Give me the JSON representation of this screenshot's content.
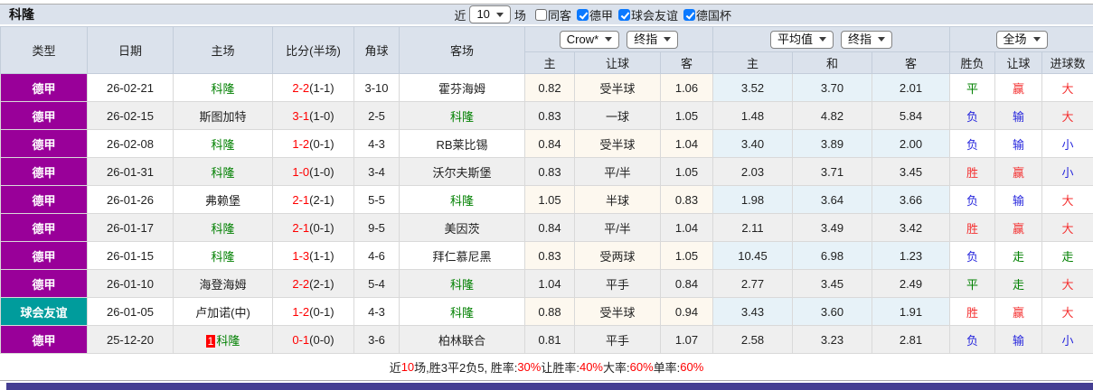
{
  "title": "科隆",
  "toolbar": {
    "near_label": "近",
    "games_select": "10",
    "games_label": "场",
    "checkboxes": [
      {
        "label": "同客",
        "checked": false
      },
      {
        "label": "德甲",
        "checked": true
      },
      {
        "label": "球会友谊",
        "checked": true
      },
      {
        "label": "德国杯",
        "checked": true
      }
    ]
  },
  "table": {
    "columns": [
      "类型",
      "日期",
      "主场",
      "比分(半场)",
      "角球",
      "客场"
    ],
    "selects": {
      "crow": "Crow*",
      "crow_final": "终指",
      "avg": "平均值",
      "avg_final": "终指",
      "scope": "全场"
    },
    "odds_subheaders": [
      "主",
      "让球",
      "客",
      "主",
      "和",
      "客",
      "胜负",
      "让球",
      "进球数"
    ],
    "rows": [
      {
        "type": "德甲",
        "type_color": "#990099",
        "date": "26-02-21",
        "home": "科隆",
        "home_green": true,
        "home_badge": "",
        "score": "2-2",
        "half": "(1-1)",
        "corner": "3-10",
        "away": "霍芬海姆",
        "away_green": false,
        "crow_home": "0.82",
        "crow_handicap": "受半球",
        "crow_away": "1.06",
        "avg_home": "3.52",
        "avg_draw": "3.70",
        "avg_away": "2.01",
        "res_outcome": "平",
        "res_outcome_color": "green",
        "res_handicap": "赢",
        "res_handicap_color": "red",
        "res_goals": "大",
        "res_goals_color": "red"
      },
      {
        "type": "德甲",
        "type_color": "#990099",
        "date": "26-02-15",
        "home": "斯图加特",
        "home_green": false,
        "home_badge": "",
        "score": "3-1",
        "half": "(1-0)",
        "corner": "2-5",
        "away": "科隆",
        "away_green": true,
        "crow_home": "0.83",
        "crow_handicap": "一球",
        "crow_away": "1.05",
        "avg_home": "1.48",
        "avg_draw": "4.82",
        "avg_away": "5.84",
        "res_outcome": "负",
        "res_outcome_color": "blue",
        "res_handicap": "输",
        "res_handicap_color": "blue",
        "res_goals": "大",
        "res_goals_color": "red"
      },
      {
        "type": "德甲",
        "type_color": "#990099",
        "date": "26-02-08",
        "home": "科隆",
        "home_green": true,
        "home_badge": "",
        "score": "1-2",
        "half": "(0-1)",
        "corner": "4-3",
        "away": "RB莱比锡",
        "away_green": false,
        "crow_home": "0.84",
        "crow_handicap": "受半球",
        "crow_away": "1.04",
        "avg_home": "3.40",
        "avg_draw": "3.89",
        "avg_away": "2.00",
        "res_outcome": "负",
        "res_outcome_color": "blue",
        "res_handicap": "输",
        "res_handicap_color": "blue",
        "res_goals": "小",
        "res_goals_color": "blue"
      },
      {
        "type": "德甲",
        "type_color": "#990099",
        "date": "26-01-31",
        "home": "科隆",
        "home_green": true,
        "home_badge": "",
        "score": "1-0",
        "half": "(1-0)",
        "corner": "3-4",
        "away": "沃尔夫斯堡",
        "away_green": false,
        "crow_home": "0.83",
        "crow_handicap": "平/半",
        "crow_away": "1.05",
        "avg_home": "2.03",
        "avg_draw": "3.71",
        "avg_away": "3.45",
        "res_outcome": "胜",
        "res_outcome_color": "red",
        "res_handicap": "赢",
        "res_handicap_color": "red",
        "res_goals": "小",
        "res_goals_color": "blue"
      },
      {
        "type": "德甲",
        "type_color": "#990099",
        "date": "26-01-26",
        "home": "弗赖堡",
        "home_green": false,
        "home_badge": "",
        "score": "2-1",
        "half": "(2-1)",
        "corner": "5-5",
        "away": "科隆",
        "away_green": true,
        "crow_home": "1.05",
        "crow_handicap": "半球",
        "crow_away": "0.83",
        "avg_home": "1.98",
        "avg_draw": "3.64",
        "avg_away": "3.66",
        "res_outcome": "负",
        "res_outcome_color": "blue",
        "res_handicap": "输",
        "res_handicap_color": "blue",
        "res_goals": "大",
        "res_goals_color": "red"
      },
      {
        "type": "德甲",
        "type_color": "#990099",
        "date": "26-01-17",
        "home": "科隆",
        "home_green": true,
        "home_badge": "",
        "score": "2-1",
        "half": "(0-1)",
        "corner": "9-5",
        "away": "美因茨",
        "away_green": false,
        "crow_home": "0.84",
        "crow_handicap": "平/半",
        "crow_away": "1.04",
        "avg_home": "2.11",
        "avg_draw": "3.49",
        "avg_away": "3.42",
        "res_outcome": "胜",
        "res_outcome_color": "red",
        "res_handicap": "赢",
        "res_handicap_color": "red",
        "res_goals": "大",
        "res_goals_color": "red"
      },
      {
        "type": "德甲",
        "type_color": "#990099",
        "date": "26-01-15",
        "home": "科隆",
        "home_green": true,
        "home_badge": "",
        "score": "1-3",
        "half": "(1-1)",
        "corner": "4-6",
        "away": "拜仁慕尼黑",
        "away_green": false,
        "crow_home": "0.83",
        "crow_handicap": "受两球",
        "crow_away": "1.05",
        "avg_home": "10.45",
        "avg_draw": "6.98",
        "avg_away": "1.23",
        "res_outcome": "负",
        "res_outcome_color": "blue",
        "res_handicap": "走",
        "res_handicap_color": "green",
        "res_goals": "走",
        "res_goals_color": "green"
      },
      {
        "type": "德甲",
        "type_color": "#990099",
        "date": "26-01-10",
        "home": "海登海姆",
        "home_green": false,
        "home_badge": "",
        "score": "2-2",
        "half": "(2-1)",
        "corner": "5-4",
        "away": "科隆",
        "away_green": true,
        "crow_home": "1.04",
        "crow_handicap": "平手",
        "crow_away": "0.84",
        "avg_home": "2.77",
        "avg_draw": "3.45",
        "avg_away": "2.49",
        "res_outcome": "平",
        "res_outcome_color": "green",
        "res_handicap": "走",
        "res_handicap_color": "green",
        "res_goals": "大",
        "res_goals_color": "red"
      },
      {
        "type": "球会友谊",
        "type_color": "#009c9c",
        "date": "26-01-05",
        "home": "卢加诺(中)",
        "home_green": false,
        "home_badge": "",
        "score": "1-2",
        "half": "(0-1)",
        "corner": "4-3",
        "away": "科隆",
        "away_green": true,
        "crow_home": "0.88",
        "crow_handicap": "受半球",
        "crow_away": "0.94",
        "avg_home": "3.43",
        "avg_draw": "3.60",
        "avg_away": "1.91",
        "res_outcome": "胜",
        "res_outcome_color": "red",
        "res_handicap": "赢",
        "res_handicap_color": "red",
        "res_goals": "大",
        "res_goals_color": "red"
      },
      {
        "type": "德甲",
        "type_color": "#990099",
        "date": "25-12-20",
        "home": "科隆",
        "home_green": true,
        "home_badge": "1",
        "score": "0-1",
        "half": "(0-0)",
        "corner": "3-6",
        "away": "柏林联合",
        "away_green": false,
        "crow_home": "0.81",
        "crow_handicap": "平手",
        "crow_away": "1.07",
        "avg_home": "2.58",
        "avg_draw": "3.23",
        "avg_away": "2.81",
        "res_outcome": "负",
        "res_outcome_color": "blue",
        "res_handicap": "输",
        "res_handicap_color": "blue",
        "res_goals": "小",
        "res_goals_color": "blue"
      }
    ]
  },
  "footer": {
    "segments": [
      {
        "text": "近",
        "red": false
      },
      {
        "text": "10",
        "red": true
      },
      {
        "text": "场,胜3平2负5, 胜率:",
        "red": false
      },
      {
        "text": "30%",
        "red": true
      },
      {
        "text": " 让胜率:",
        "red": false
      },
      {
        "text": "40%",
        "red": true
      },
      {
        "text": " 大率:",
        "red": false
      },
      {
        "text": "60%",
        "red": true
      },
      {
        "text": " 单率:",
        "red": false
      },
      {
        "text": "60%",
        "red": true
      }
    ]
  },
  "colors": {
    "league_bundesliga": "#990099",
    "league_friendly": "#009c9c",
    "team_highlight": "#008000",
    "score_red": "#ff0000",
    "result_red": "#f43131",
    "result_blue": "#2626dd",
    "result_green": "#008000",
    "header_bg": "#dbe2ec",
    "crow_col_bg": "#fdf8ef",
    "avg_col_bg": "#e7f2f8",
    "bottom_bar": "#453e92"
  }
}
